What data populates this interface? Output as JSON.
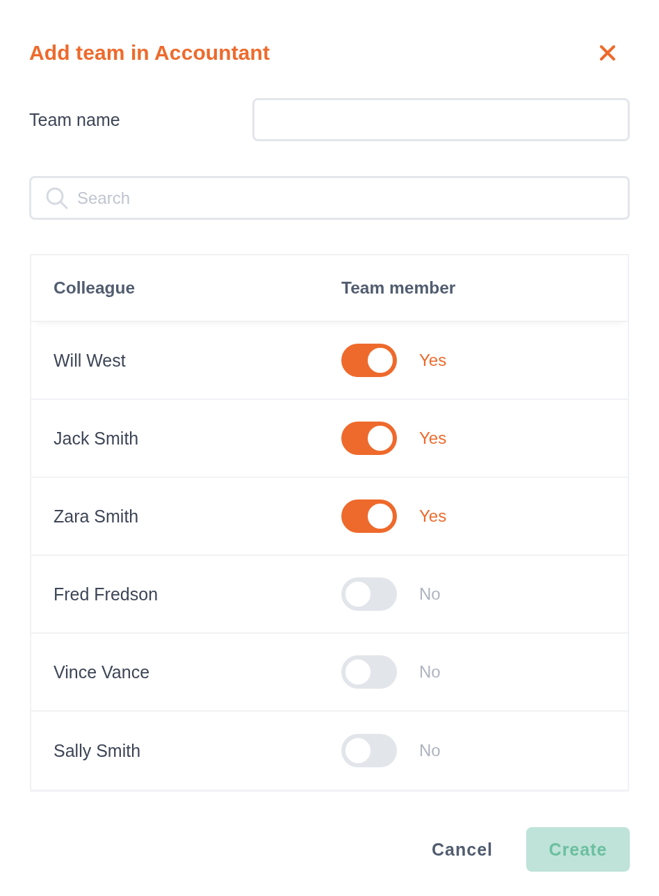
{
  "dialog": {
    "title": "Add team in Accountant"
  },
  "team_name": {
    "label": "Team name"
  },
  "search": {
    "placeholder": "Search"
  },
  "table": {
    "columns": [
      "Colleague",
      "Team member"
    ],
    "rows": [
      {
        "name": "Will West",
        "on": true,
        "status": "Yes"
      },
      {
        "name": "Jack Smith",
        "on": true,
        "status": "Yes"
      },
      {
        "name": "Zara Smith",
        "on": true,
        "status": "Yes"
      },
      {
        "name": "Fred Fredson",
        "on": false,
        "status": "No"
      },
      {
        "name": "Vince Vance",
        "on": false,
        "status": "No"
      },
      {
        "name": "Sally Smith",
        "on": false,
        "status": "No"
      }
    ]
  },
  "buttons": [
    {
      "label": "Cancel",
      "kind": "text",
      "disabled": false
    },
    {
      "label": "Create",
      "kind": "primary",
      "disabled": true
    }
  ]
}
